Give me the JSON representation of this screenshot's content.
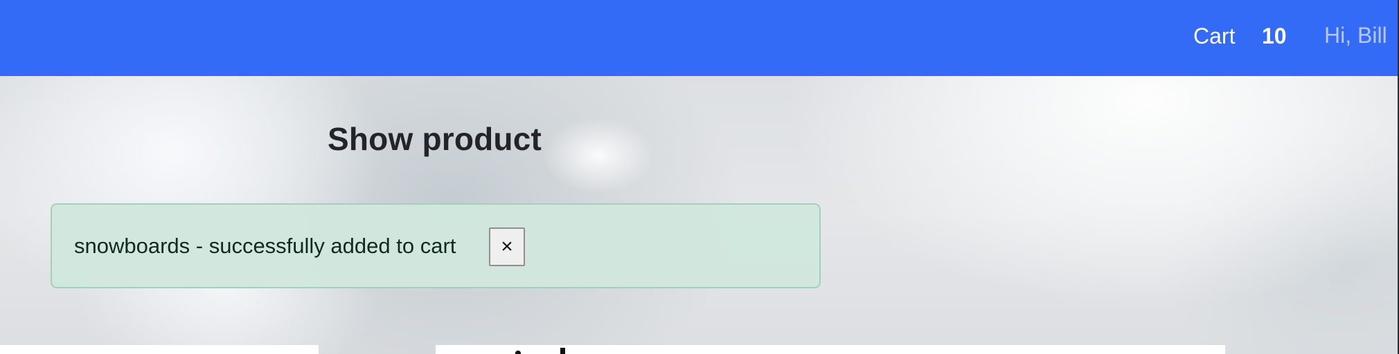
{
  "nav": {
    "cart_label": "Cart",
    "cart_count": "10",
    "greeting": "Hi, Bill"
  },
  "page": {
    "title": "Show product"
  },
  "alert": {
    "message": "snowboards - successfully added to cart",
    "close_label": "×"
  },
  "colors": {
    "navbar": "#346bf6",
    "alert_background": "#d1e7dd",
    "alert_border": "#a3cfbb",
    "title_text": "#212529"
  }
}
